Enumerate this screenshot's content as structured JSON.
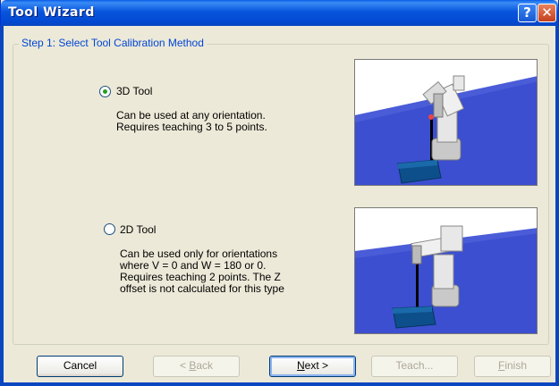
{
  "window": {
    "title": "Tool Wizard",
    "help_glyph": "?",
    "close_glyph": "✕"
  },
  "group": {
    "legend": "Step 1: Select Tool Calibration Method"
  },
  "options": [
    {
      "label": "3D Tool",
      "selected": true,
      "description": [
        "Can be used at any orientation.",
        "Requires teaching 3 to 5 points."
      ]
    },
    {
      "label": "2D Tool",
      "selected": false,
      "description": [
        "Can be used only for orientations",
        "where V = 0 and W = 180 or 0.",
        "Requires teaching 2 points.  The Z",
        "offset is not calculated for this type"
      ]
    }
  ],
  "buttons": {
    "cancel": "Cancel",
    "back": {
      "mnemonic": "B",
      "rest": "ack",
      "prefix": "< "
    },
    "next": {
      "mnemonic": "N",
      "rest": "ext",
      "suffix": " >"
    },
    "teach": "Teach...",
    "finish": {
      "mnemonic": "F",
      "rest": "inish"
    }
  },
  "colors": {
    "accent": "#0046d5",
    "titlebar": "#0a5ce8",
    "floor": "#3c4fd0",
    "selected_radio": "#21a121"
  }
}
